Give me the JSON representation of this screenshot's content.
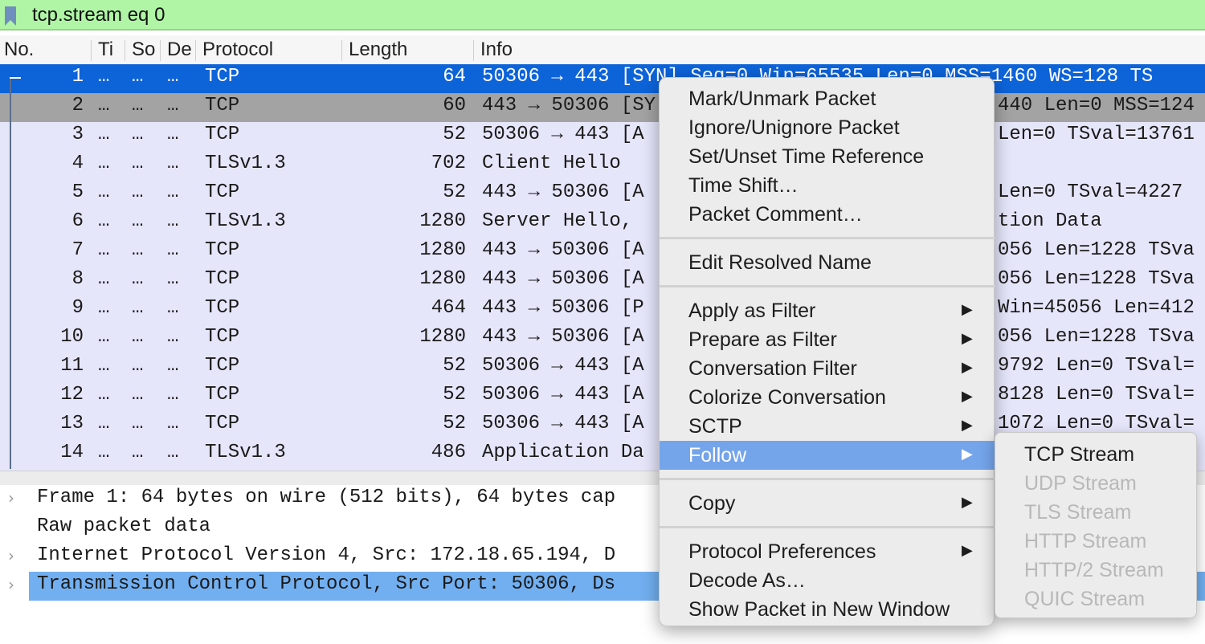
{
  "filter": {
    "text": "tcp.stream eq 0",
    "bar_color": "#b0f5a6",
    "bookmark_icon": "bookmark-icon"
  },
  "columns": [
    "No.",
    "Time",
    "Source",
    "Destination",
    "Protocol",
    "Length",
    "Info"
  ],
  "columns_display": [
    "No.",
    "Ti",
    "So",
    "De",
    "Protocol",
    "Length",
    "Info"
  ],
  "packets": [
    {
      "no": "1",
      "time": "…",
      "src": "…",
      "dst": "…",
      "proto": "TCP",
      "len": "64",
      "info": "50306 → 443 [SYN] Seq=0 Win=65535 Len=0 MSS=1460 WS=128 TS",
      "state": "selected"
    },
    {
      "no": "2",
      "time": "…",
      "src": "…",
      "dst": "…",
      "proto": "TCP",
      "len": "60",
      "info": "443 → 50306 [SY",
      "info_tail": "440 Len=0 MSS=124",
      "state": "related"
    },
    {
      "no": "3",
      "time": "…",
      "src": "…",
      "dst": "…",
      "proto": "TCP",
      "len": "52",
      "info": "50306 → 443 [A",
      "info_tail": "Len=0 TSval=13761"
    },
    {
      "no": "4",
      "time": "…",
      "src": "…",
      "dst": "…",
      "proto": "TLSv1.3",
      "len": "702",
      "info": "Client Hello",
      "info_tail": ""
    },
    {
      "no": "5",
      "time": "…",
      "src": "…",
      "dst": "…",
      "proto": "TCP",
      "len": "52",
      "info": "443 → 50306 [A",
      "info_tail": "Len=0 TSval=4227"
    },
    {
      "no": "6",
      "time": "…",
      "src": "…",
      "dst": "…",
      "proto": "TLSv1.3",
      "len": "1280",
      "info": "Server Hello,",
      "info_tail": "tion Data"
    },
    {
      "no": "7",
      "time": "…",
      "src": "…",
      "dst": "…",
      "proto": "TCP",
      "len": "1280",
      "info": "443 → 50306 [A",
      "info_tail": "056 Len=1228 TSva"
    },
    {
      "no": "8",
      "time": "…",
      "src": "…",
      "dst": "…",
      "proto": "TCP",
      "len": "1280",
      "info": "443 → 50306 [A",
      "info_tail": "056 Len=1228 TSva"
    },
    {
      "no": "9",
      "time": "…",
      "src": "…",
      "dst": "…",
      "proto": "TCP",
      "len": "464",
      "info": "443 → 50306 [P",
      "info_tail": "Win=45056 Len=412"
    },
    {
      "no": "10",
      "time": "…",
      "src": "…",
      "dst": "…",
      "proto": "TCP",
      "len": "1280",
      "info": "443 → 50306 [A",
      "info_tail": "056 Len=1228 TSva"
    },
    {
      "no": "11",
      "time": "…",
      "src": "…",
      "dst": "…",
      "proto": "TCP",
      "len": "52",
      "info": "50306 → 443 [A",
      "info_tail": "9792 Len=0 TSval="
    },
    {
      "no": "12",
      "time": "…",
      "src": "…",
      "dst": "…",
      "proto": "TCP",
      "len": "52",
      "info": "50306 → 443 [A",
      "info_tail": "8128 Len=0 TSval="
    },
    {
      "no": "13",
      "time": "…",
      "src": "…",
      "dst": "…",
      "proto": "TCP",
      "len": "52",
      "info": "50306 → 443 [A",
      "info_tail": "1072 Len=0 TSval="
    },
    {
      "no": "14",
      "time": "…",
      "src": "…",
      "dst": "…",
      "proto": "TLSv1.3",
      "len": "486",
      "info": "Application Da",
      "info_tail": ""
    }
  ],
  "details": [
    {
      "text": "Frame 1: 64 bytes on wire (512 bits), 64 bytes cap",
      "expandable": true
    },
    {
      "text": "Raw packet data",
      "expandable": false
    },
    {
      "text": "Internet Protocol Version 4, Src: 172.18.65.194, D",
      "expandable": true
    },
    {
      "text": "Transmission Control Protocol, Src Port: 50306, Ds",
      "expandable": true,
      "highlighted": true
    }
  ],
  "context_menu": {
    "groups": [
      [
        {
          "label": "Mark/Unmark Packet"
        },
        {
          "label": "Ignore/Unignore Packet"
        },
        {
          "label": "Set/Unset Time Reference"
        },
        {
          "label": "Time Shift…"
        },
        {
          "label": "Packet Comment…"
        }
      ],
      [
        {
          "label": "Edit Resolved Name"
        }
      ],
      [
        {
          "label": "Apply as Filter",
          "submenu": true
        },
        {
          "label": "Prepare as Filter",
          "submenu": true
        },
        {
          "label": "Conversation Filter",
          "submenu": true
        },
        {
          "label": "Colorize Conversation",
          "submenu": true
        },
        {
          "label": "SCTP",
          "submenu": true
        },
        {
          "label": "Follow",
          "submenu": true,
          "active": true
        }
      ],
      [
        {
          "label": "Copy",
          "submenu": true
        }
      ],
      [
        {
          "label": "Protocol Preferences",
          "submenu": true
        },
        {
          "label": "Decode As…"
        },
        {
          "label": "Show Packet in New Window"
        }
      ]
    ]
  },
  "follow_submenu": [
    {
      "label": "TCP Stream",
      "enabled": true
    },
    {
      "label": "UDP Stream",
      "enabled": false
    },
    {
      "label": "TLS Stream",
      "enabled": false
    },
    {
      "label": "HTTP Stream",
      "enabled": false
    },
    {
      "label": "HTTP/2 Stream",
      "enabled": false
    },
    {
      "label": "QUIC Stream",
      "enabled": false
    }
  ],
  "colors": {
    "selected_row": "#0d63d8",
    "related_row": "#a3a3a3",
    "tcp_row": "#e6e6fb",
    "menu_highlight": "#74a4ea",
    "detail_highlight": "#72aff0"
  }
}
